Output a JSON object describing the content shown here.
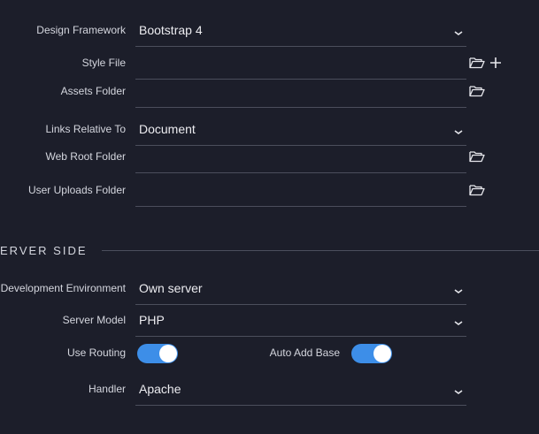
{
  "settings": {
    "design_framework": {
      "label": "Design Framework",
      "value": "Bootstrap 4"
    },
    "style_file": {
      "label": "Style File",
      "value": ""
    },
    "assets_folder": {
      "label": "Assets Folder",
      "value": ""
    },
    "links_relative_to": {
      "label": "Links Relative To",
      "value": "Document"
    },
    "web_root_folder": {
      "label": "Web Root Folder",
      "value": ""
    },
    "user_uploads_folder": {
      "label": "User Uploads Folder",
      "value": ""
    }
  },
  "server_side": {
    "section_title": "ERVER SIDE",
    "development_environment": {
      "label": "Development Environment",
      "value": "Own server"
    },
    "server_model": {
      "label": "Server Model",
      "value": "PHP"
    },
    "use_routing": {
      "label": "Use Routing",
      "enabled": true
    },
    "auto_add_base": {
      "label": "Auto Add Base",
      "enabled": true
    },
    "handler": {
      "label": "Handler",
      "value": "Apache"
    }
  },
  "icons": {
    "folder": "folder-open-icon",
    "plus": "plus-icon",
    "chevron": "chevron-down-icon"
  },
  "colors": {
    "background": "#1c1e2a",
    "underline": "#4b4e5c",
    "toggle_on": "#3d8ee8",
    "text": "#e6e7ec"
  }
}
